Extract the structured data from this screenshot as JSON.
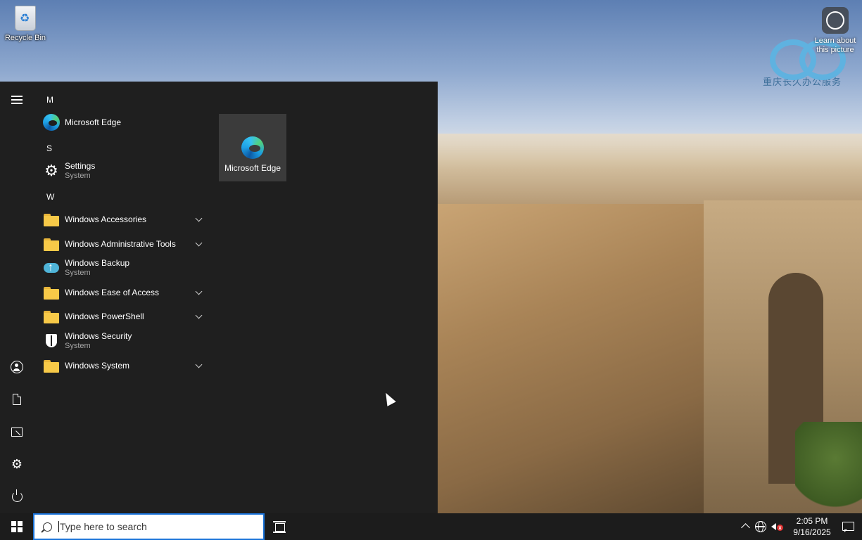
{
  "desktop": {
    "icons": [
      {
        "label": "Recycle Bin",
        "icon": "recycle-bin-icon"
      },
      {
        "label": "Learn about this picture",
        "icon": "learn-about-picture-icon"
      }
    ],
    "watermark_text": "重庆长久办公服务"
  },
  "start_menu": {
    "rail": [
      {
        "name": "menu",
        "icon": "hamburger-icon"
      },
      {
        "name": "account",
        "icon": "user-icon"
      },
      {
        "name": "documents",
        "icon": "document-icon"
      },
      {
        "name": "pictures",
        "icon": "pictures-icon"
      },
      {
        "name": "settings",
        "icon": "gear-icon"
      },
      {
        "name": "power",
        "icon": "power-icon"
      }
    ],
    "letters": {
      "m": "M",
      "s": "S",
      "w": "W"
    },
    "apps": [
      {
        "name": "Microsoft Edge",
        "sub": "",
        "icon": "edge-icon",
        "expandable": false
      },
      {
        "name": "Settings",
        "sub": "System",
        "icon": "gear-icon",
        "expandable": false
      },
      {
        "name": "Windows Accessories",
        "sub": "",
        "icon": "folder-icon",
        "expandable": true
      },
      {
        "name": "Windows Administrative Tools",
        "sub": "",
        "icon": "folder-icon",
        "expandable": true
      },
      {
        "name": "Windows Backup",
        "sub": "System",
        "icon": "backup-icon",
        "expandable": false
      },
      {
        "name": "Windows Ease of Access",
        "sub": "",
        "icon": "folder-icon",
        "expandable": true
      },
      {
        "name": "Windows PowerShell",
        "sub": "",
        "icon": "folder-icon",
        "expandable": true
      },
      {
        "name": "Windows Security",
        "sub": "System",
        "icon": "shield-icon",
        "expandable": false
      },
      {
        "name": "Windows System",
        "sub": "",
        "icon": "folder-icon",
        "expandable": true
      }
    ],
    "tiles": [
      {
        "label": "Microsoft Edge",
        "icon": "edge-icon"
      }
    ]
  },
  "taskbar": {
    "search_placeholder": "Type here to search",
    "time": "2:05 PM",
    "date": "9/16/2025"
  },
  "colors": {
    "start_bg": "#1f1f1f",
    "taskbar_bg": "#1c1c1c",
    "tile_bg": "#3b3b3b",
    "search_border": "#1a73d9",
    "folder": "#f7c948"
  }
}
